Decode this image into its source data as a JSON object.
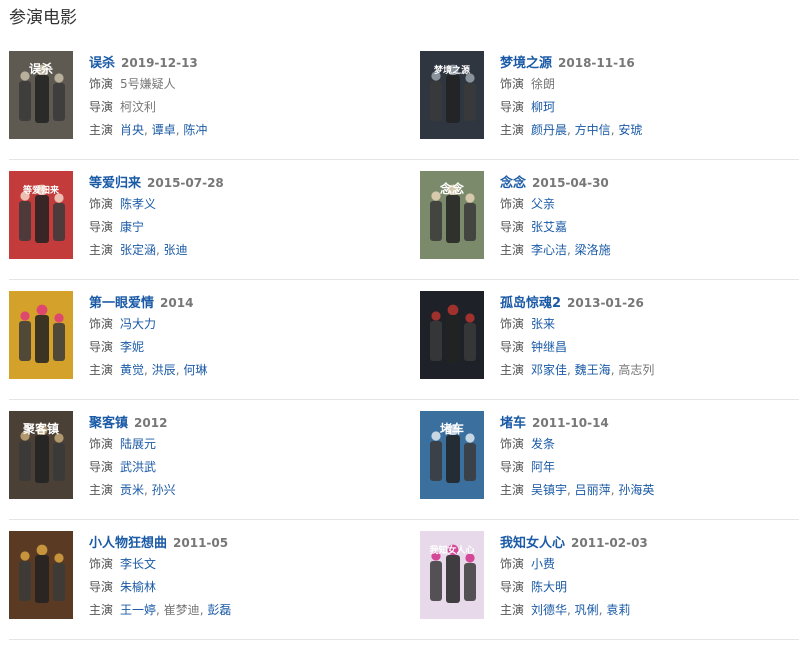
{
  "section": {
    "title": "参演电影"
  },
  "labels": {
    "role": "饰演",
    "director": "导演",
    "cast": "主演"
  },
  "movies": [
    {
      "title": "误杀",
      "date": "2019-12-13",
      "role": "5号嫌疑人",
      "role_link": false,
      "directors": [
        "柯汶利"
      ],
      "director_link": false,
      "cast": [
        "肖央",
        "谭卓",
        "陈冲"
      ],
      "cast_links": [
        true,
        true,
        true
      ],
      "poster": {
        "bg": "#5e5a52",
        "accent": "#c9bfa8",
        "text": "误杀"
      }
    },
    {
      "title": "梦境之源",
      "date": "2018-11-16",
      "role": "徐朗",
      "role_link": false,
      "directors": [
        "柳珂"
      ],
      "director_link": true,
      "cast": [
        "颜丹晨",
        "方中信",
        "安琥"
      ],
      "cast_links": [
        true,
        true,
        true
      ],
      "poster": {
        "bg": "#2f3640",
        "accent": "#9aa4ad",
        "text": "梦境之源"
      }
    },
    {
      "title": "等爱归来",
      "date": "2015-07-28",
      "role": "陈孝义",
      "role_link": true,
      "directors": [
        "康宁"
      ],
      "director_link": true,
      "cast": [
        "张定涵",
        "张迪"
      ],
      "cast_links": [
        true,
        true
      ],
      "poster": {
        "bg": "#c33b3b",
        "accent": "#f2d8c9",
        "text": "等爱归来"
      }
    },
    {
      "title": "念念",
      "date": "2015-04-30",
      "role": "父亲",
      "role_link": true,
      "directors": [
        "张艾嘉"
      ],
      "director_link": true,
      "cast": [
        "李心洁",
        "梁洛施"
      ],
      "cast_links": [
        true,
        true
      ],
      "poster": {
        "bg": "#7b8a6a",
        "accent": "#e6d4b8",
        "text": "念念"
      }
    },
    {
      "title": "第一眼爱情",
      "date": "2014",
      "role": "冯大力",
      "role_link": true,
      "directors": [
        "李妮"
      ],
      "director_link": true,
      "cast": [
        "黄觉",
        "洪辰",
        "何琳"
      ],
      "cast_links": [
        true,
        true,
        true
      ],
      "poster": {
        "bg": "#d4a12a",
        "accent": "#e0397a",
        "text": ""
      }
    },
    {
      "title": "孤岛惊魂2",
      "date": "2013-01-26",
      "role": "张来",
      "role_link": true,
      "directors": [
        "钟继昌"
      ],
      "director_link": true,
      "cast": [
        "邓家佳",
        "魏王海",
        "高志列"
      ],
      "cast_links": [
        true,
        true,
        false
      ],
      "poster": {
        "bg": "#1e2228",
        "accent": "#b8342e",
        "text": ""
      }
    },
    {
      "title": "聚客镇",
      "date": "2012",
      "role": "陆展元",
      "role_link": true,
      "directors": [
        "武洪武"
      ],
      "director_link": true,
      "cast": [
        "贡米",
        "孙兴"
      ],
      "cast_links": [
        true,
        true
      ],
      "poster": {
        "bg": "#4a4036",
        "accent": "#c4a878",
        "text": "聚客镇"
      }
    },
    {
      "title": "堵车",
      "date": "2011-10-14",
      "role": "发条",
      "role_link": true,
      "directors": [
        "阿年"
      ],
      "director_link": true,
      "cast": [
        "吴镇宇",
        "吕丽萍",
        "孙海英"
      ],
      "cast_links": [
        true,
        true,
        true
      ],
      "poster": {
        "bg": "#3b6f9e",
        "accent": "#dfe8f0",
        "text": "堵车"
      }
    },
    {
      "title": "小人物狂想曲",
      "date": "2011-05",
      "role": "李长文",
      "role_link": true,
      "directors": [
        "朱榆林"
      ],
      "director_link": true,
      "cast": [
        "王一婷",
        "崔梦迪",
        "彭磊"
      ],
      "cast_links": [
        true,
        false,
        true
      ],
      "poster": {
        "bg": "#5a3a22",
        "accent": "#d9a441",
        "text": ""
      }
    },
    {
      "title": "我知女人心",
      "date": "2011-02-03",
      "role": "小费",
      "role_link": true,
      "directors": [
        "陈大明"
      ],
      "director_link": true,
      "cast": [
        "刘德华",
        "巩俐",
        "袁莉"
      ],
      "cast_links": [
        true,
        true,
        true
      ],
      "poster": {
        "bg": "#e7d9ea",
        "accent": "#d0308a",
        "text": "我知女人心"
      }
    }
  ],
  "colors": {
    "link": "#1a5aa6",
    "muted": "#777777",
    "divider": "#e5e5e5"
  }
}
